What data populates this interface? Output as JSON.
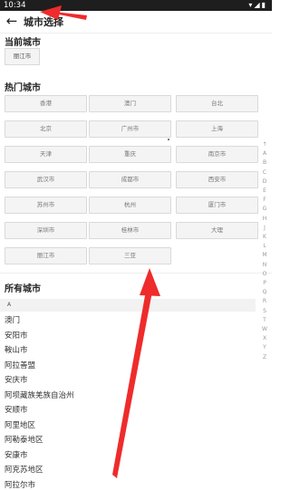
{
  "status": {
    "time": "10:34",
    "icons": "▾◢▮"
  },
  "header": {
    "title": "城市选择"
  },
  "current": {
    "heading": "当前城市",
    "city": "丽江市"
  },
  "hot": {
    "heading": "热门城市",
    "cities": [
      "香港",
      "澳门",
      "台北",
      "北京",
      "广州市",
      "上海",
      "天津",
      "重庆",
      "南京市",
      "武汉市",
      "成都市",
      "西安市",
      "苏州市",
      "杭州",
      "厦门市",
      "深圳市",
      "桂林市",
      "大理",
      "丽江市",
      "三亚"
    ]
  },
  "all": {
    "heading": "所有城市",
    "letter": "A",
    "cities": [
      "澳门",
      "安阳市",
      "鞍山市",
      "阿拉善盟",
      "安庆市",
      "阿坝藏族羌族自治州",
      "安顺市",
      "阿里地区",
      "阿勒泰地区",
      "安康市",
      "阿克苏地区",
      "阿拉尔市"
    ]
  },
  "index": [
    "↑",
    "A",
    "B",
    "C",
    "D",
    "E",
    "F",
    "G",
    "H",
    "J",
    "K",
    "L",
    "M",
    "N",
    "O",
    "P",
    "Q",
    "R",
    "S",
    "T",
    "W",
    "X",
    "Y",
    "Z"
  ],
  "annotations": {
    "arrow_color": "#ef2b2b"
  }
}
